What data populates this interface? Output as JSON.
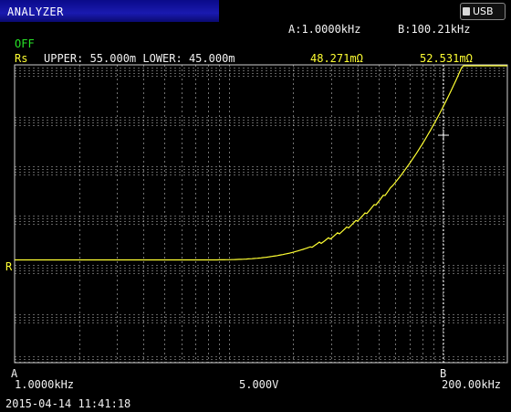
{
  "window": {
    "title": "ANALYZER",
    "badge_icon": "usb-icon",
    "badge_label": "USB"
  },
  "header": {
    "cursor_a": "A:1.0000kHz",
    "cursor_b": "B:100.21kHz",
    "status": "OFF",
    "param": "Rs",
    "limits": "UPPER: 55.000m LOWER: 45.000m",
    "value_a": "48.271mΩ",
    "value_b": "52.531mΩ"
  },
  "plot": {
    "reference_marker": "R",
    "marker_a": "A",
    "marker_b": "B",
    "x_start": "1.0000kHz",
    "x_center": "5.000V",
    "x_end": "200.00kHz",
    "trace_color": "#ffff33",
    "grid_color": "#bfbfbf",
    "cursor_color": "#ffffff"
  },
  "footer": {
    "timestamp": "2015-04-14 11:41:18"
  }
}
